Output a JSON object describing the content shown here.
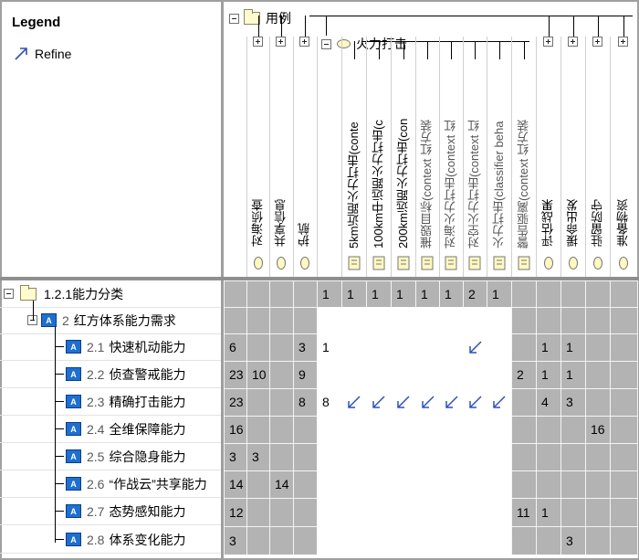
{
  "legend": {
    "title": "Legend",
    "items": [
      {
        "label": "Refine",
        "icon": "refine-arrow-icon"
      }
    ]
  },
  "colors": {
    "gray_cell": "#b3b3b3",
    "white_cell": "#ffffff",
    "refine_arrow": "#2f50b8",
    "element_icon": "#1e6fd0"
  },
  "column_tree": {
    "root": {
      "label": "用例",
      "expanded": true,
      "icon": "folder-icon"
    },
    "group": {
      "label": "火力打击",
      "expanded": true,
      "icon": "usecase-icon"
    }
  },
  "columns": [
    {
      "label": "对海侦查",
      "icon": "usecase-icon",
      "type": "usecase"
    },
    {
      "label": "共享信息",
      "icon": "usecase-icon",
      "type": "usecase"
    },
    {
      "label": "护航",
      "icon": "usecase-icon",
      "type": "usecase"
    },
    {
      "label": "",
      "icon": "",
      "type": "group"
    },
    {
      "label": "5km近距火力打击(conte",
      "icon": "document-icon",
      "type": "behavior"
    },
    {
      "label": "100km中远距火力打击(c",
      "icon": "document-icon",
      "type": "behavior"
    },
    {
      "label": "200km远距火力打击(con",
      "icon": "document-icon",
      "type": "behavior"
    },
    {
      "label": "摧毁目标(context 红方装",
      "icon": "document-icon",
      "type": "behavior"
    },
    {
      "label": "对海火力打击(context 红",
      "icon": "document-icon",
      "type": "behavior"
    },
    {
      "label": "对空火力打击(context 红",
      "icon": "document-icon",
      "type": "behavior"
    },
    {
      "label": "火力打击(classifier beha",
      "icon": "document-icon",
      "type": "behavior"
    },
    {
      "label": "警告驱离(context 红方装",
      "icon": "document-icon",
      "type": "behavior"
    },
    {
      "label": "评估战果",
      "icon": "usecase-icon",
      "type": "usecase"
    },
    {
      "label": "援命出发",
      "icon": "usecase-icon",
      "type": "usecase"
    },
    {
      "label": "驻留防守",
      "icon": "usecase-icon",
      "type": "usecase"
    },
    {
      "label": "准备物资",
      "icon": "usecase-icon",
      "type": "usecase"
    }
  ],
  "rows": [
    {
      "num": "",
      "label": "1.2.1能力分类",
      "icon": "folder-icon",
      "level": 0,
      "toggle": "minus"
    },
    {
      "num": "2",
      "label": "红方体系能力需求",
      "icon": "element-icon",
      "level": 1,
      "toggle": "minus"
    },
    {
      "num": "2.1",
      "label": "快速机动能力",
      "icon": "element-icon",
      "level": 2,
      "toggle": ""
    },
    {
      "num": "2.2",
      "label": "侦查警戒能力",
      "icon": "element-icon",
      "level": 2,
      "toggle": ""
    },
    {
      "num": "2.3",
      "label": "精确打击能力",
      "icon": "element-icon",
      "level": 2,
      "toggle": ""
    },
    {
      "num": "2.4",
      "label": "全维保障能力",
      "icon": "element-icon",
      "level": 2,
      "toggle": ""
    },
    {
      "num": "2.5",
      "label": "综合隐身能力",
      "icon": "element-icon",
      "level": 2,
      "toggle": ""
    },
    {
      "num": "2.6",
      "label": "“作战云”共享能力",
      "icon": "element-icon",
      "level": 2,
      "toggle": ""
    },
    {
      "num": "2.7",
      "label": "态势感知能力",
      "icon": "element-icon",
      "level": 2,
      "toggle": ""
    },
    {
      "num": "2.8",
      "label": "体系变化能力",
      "icon": "element-icon",
      "level": 2,
      "toggle": ""
    }
  ],
  "row_totals": [
    "",
    "",
    "6",
    "23",
    "23",
    "16",
    "3",
    "14",
    "12",
    "3"
  ],
  "matrix": [
    [
      "",
      "",
      "",
      "1",
      "1",
      "1",
      "1",
      "1",
      "1",
      "2",
      "1",
      "",
      "",
      "",
      ""
    ],
    [
      "",
      "",
      "",
      "",
      "",
      "",
      "",
      "",
      "",
      "",
      "",
      "",
      "",
      "",
      ""
    ],
    [
      "",
      "",
      "3",
      "1",
      "",
      "",
      "",
      "",
      "",
      "↙",
      "",
      "",
      "1",
      "1",
      ""
    ],
    [
      "10",
      "",
      "9",
      "",
      "",
      "",
      "",
      "",
      "",
      "",
      "",
      "2",
      "1",
      "1",
      ""
    ],
    [
      "",
      "",
      "8",
      "8",
      "↙",
      "↙",
      "↙",
      "↙",
      "↙",
      "↙",
      "↙",
      "",
      "4",
      "3",
      ""
    ],
    [
      "",
      "",
      "",
      "",
      "",
      "",
      "",
      "",
      "",
      "",
      "",
      "",
      "",
      "",
      "16"
    ],
    [
      "3",
      "",
      "",
      "",
      "",
      "",
      "",
      "",
      "",
      "",
      "",
      "",
      "",
      "",
      ""
    ],
    [
      "",
      "14",
      "",
      "",
      "",
      "",
      "",
      "",
      "",
      "",
      "",
      "",
      "",
      "",
      ""
    ],
    [
      "",
      "",
      "",
      "",
      "",
      "",
      "",
      "",
      "",
      "",
      "",
      "11",
      "1",
      "",
      ""
    ],
    [
      "",
      "",
      "",
      "",
      "",
      "",
      "",
      "",
      "",
      "",
      "",
      "",
      "",
      "3",
      ""
    ]
  ],
  "white_region": {
    "rows_from": 1,
    "cols": [
      4,
      5,
      6,
      7,
      8,
      9,
      10,
      11
    ]
  }
}
